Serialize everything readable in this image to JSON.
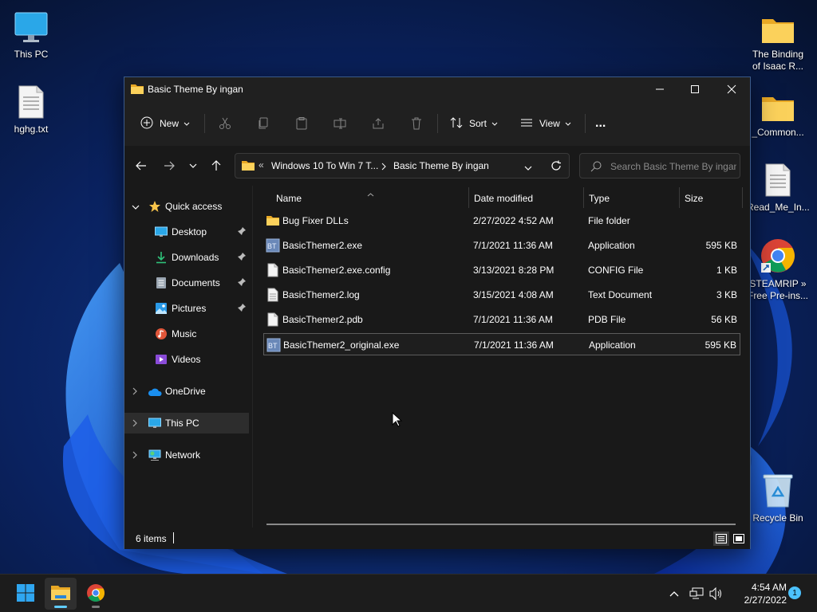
{
  "desktop": {
    "icons": [
      {
        "name": "This PC",
        "icon": "monitor-icon"
      },
      {
        "name": "hghg.txt",
        "icon": "text-file-icon"
      },
      {
        "name": "The Binding\nof Isaac R...",
        "icon": "folder-icon"
      },
      {
        "name": "_Common...",
        "icon": "folder-icon"
      },
      {
        "name": "Read_Me_In...",
        "icon": "text-file-icon"
      },
      {
        "name": "STEAMRIP  »\nFree Pre-ins...",
        "icon": "chrome-shortcut-icon"
      },
      {
        "name": "Recycle Bin",
        "icon": "recycle-bin-icon"
      }
    ]
  },
  "window": {
    "title": "Basic Theme By ingan",
    "command_bar": {
      "new_label": "New",
      "sort_label": "Sort",
      "view_label": "View",
      "more_label": "..."
    },
    "address": {
      "overflow": "«",
      "crumbs": [
        "Windows 10 To Win 7 T...",
        "Basic Theme By ingan"
      ]
    },
    "search_placeholder": "Search Basic Theme By ingan",
    "sidebar": {
      "quick_access": "Quick access",
      "quick_items": [
        {
          "label": "Desktop",
          "pinned": true
        },
        {
          "label": "Downloads",
          "pinned": true
        },
        {
          "label": "Documents",
          "pinned": true
        },
        {
          "label": "Pictures",
          "pinned": true
        },
        {
          "label": "Music",
          "pinned": false
        },
        {
          "label": "Videos",
          "pinned": false
        }
      ],
      "onedrive": "OneDrive",
      "this_pc": "This PC",
      "network": "Network"
    },
    "columns": {
      "name": "Name",
      "date": "Date modified",
      "type": "Type",
      "size": "Size"
    },
    "files": [
      {
        "name": "Bug Fixer DLLs",
        "date": "2/27/2022 4:52 AM",
        "type": "File folder",
        "size": "",
        "icon": "folder-icon"
      },
      {
        "name": "BasicThemer2.exe",
        "date": "7/1/2021 11:36 AM",
        "type": "Application",
        "size": "595 KB",
        "icon": "app-icon"
      },
      {
        "name": "BasicThemer2.exe.config",
        "date": "3/13/2021 8:28 PM",
        "type": "CONFIG File",
        "size": "1 KB",
        "icon": "file-icon"
      },
      {
        "name": "BasicThemer2.log",
        "date": "3/15/2021 4:08 AM",
        "type": "Text Document",
        "size": "3 KB",
        "icon": "text-file-icon"
      },
      {
        "name": "BasicThemer2.pdb",
        "date": "7/1/2021 11:36 AM",
        "type": "PDB File",
        "size": "56 KB",
        "icon": "file-icon"
      },
      {
        "name": "BasicThemer2_original.exe",
        "date": "7/1/2021 11:36 AM",
        "type": "Application",
        "size": "595 KB",
        "icon": "app-icon"
      }
    ],
    "app_icon_text": "BT",
    "status": {
      "count": "6 items"
    }
  },
  "taskbar": {
    "time": "4:54 AM",
    "date": "2/27/2022",
    "notifications": "1"
  },
  "colors": {
    "accent": "#60cdff",
    "folder": "#f8c44a",
    "window_bg": "#191919",
    "taskbar_bg": "#1c1c1c"
  }
}
